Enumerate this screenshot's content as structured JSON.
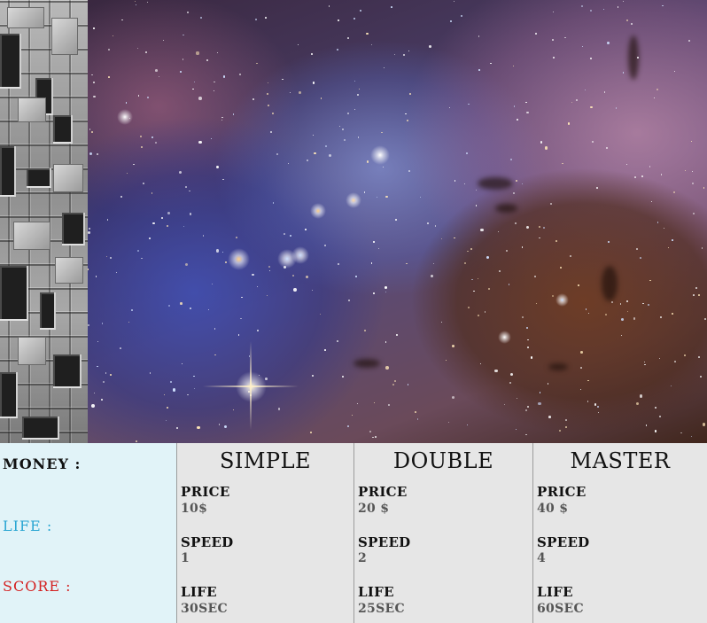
{
  "stats": {
    "money_label": "MONEY :",
    "life_label": "LIFE :",
    "score_label": "SCORE :"
  },
  "colors": {
    "money": "#111111",
    "life": "#2aa6d2",
    "score": "#d42020",
    "stats_bg": "#e1f3f8",
    "shop_bg": "#e6e6e6"
  },
  "shop": [
    {
      "title": "SIMPLE",
      "price_label": "PRICE",
      "price": "10$",
      "speed_label": "SPEED",
      "speed": "1",
      "life_label": "LIFE",
      "life": "30SEC"
    },
    {
      "title": "DOUBLE",
      "price_label": "PRICE",
      "price": "20 $",
      "speed_label": "SPEED",
      "speed": "2",
      "life_label": "LIFE",
      "life": "25SEC"
    },
    {
      "title": "MASTER",
      "price_label": "PRICE",
      "price": "40 $",
      "speed_label": "SPEED",
      "speed": "4",
      "life_label": "LIFE",
      "life": "60SEC"
    }
  ]
}
